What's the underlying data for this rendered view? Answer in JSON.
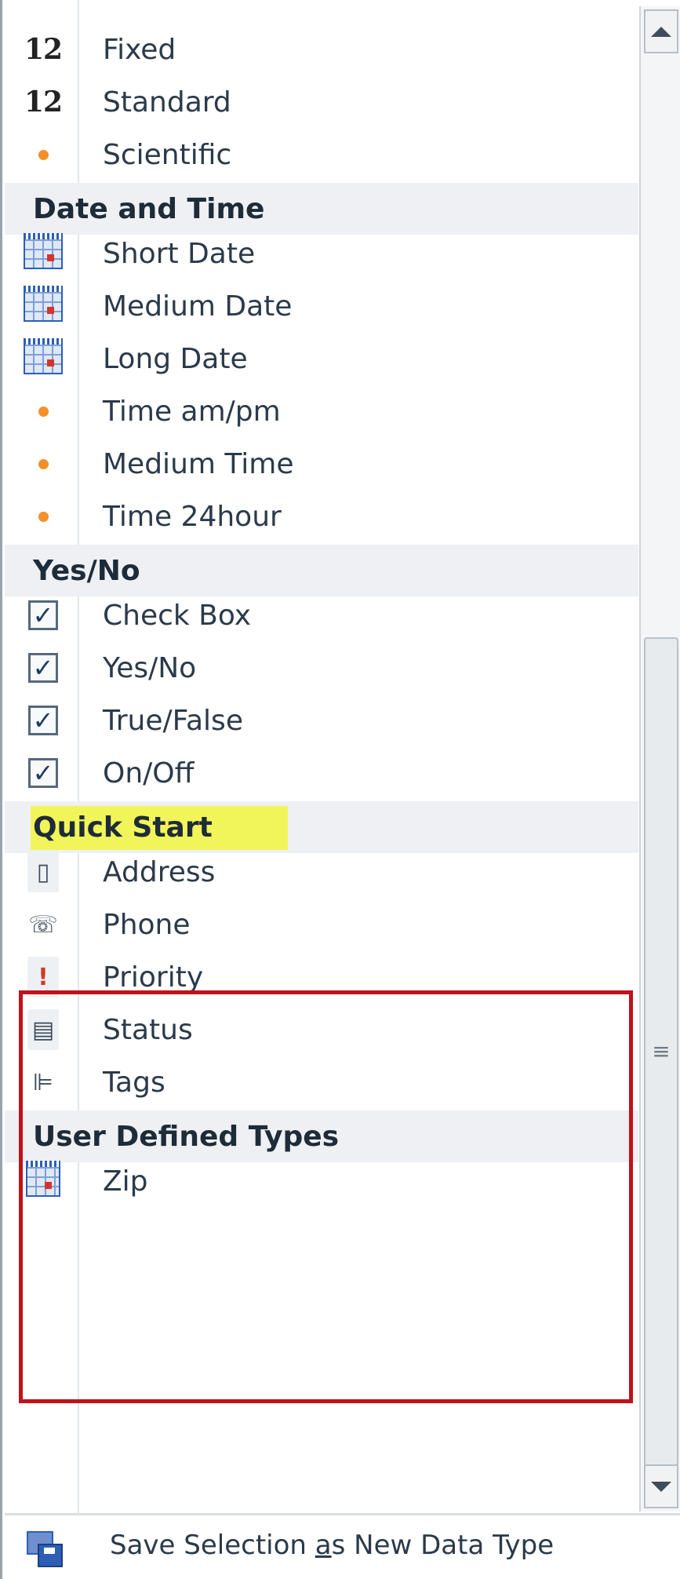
{
  "groups": [
    {
      "title": "",
      "items": [
        {
          "label": "Fixed",
          "icon": "number-12-icon"
        },
        {
          "label": "Standard",
          "icon": "number-12-icon"
        },
        {
          "label": "Scientific",
          "icon": "orange-dot-icon"
        }
      ]
    },
    {
      "title": "Date and Time",
      "items": [
        {
          "label": "Short Date",
          "icon": "calendar-icon"
        },
        {
          "label": "Medium Date",
          "icon": "calendar-icon"
        },
        {
          "label": "Long Date",
          "icon": "calendar-icon"
        },
        {
          "label": "Time am/pm",
          "icon": "orange-dot-icon"
        },
        {
          "label": "Medium Time",
          "icon": "orange-dot-icon"
        },
        {
          "label": "Time 24hour",
          "icon": "orange-dot-icon"
        }
      ]
    },
    {
      "title": "Yes/No",
      "items": [
        {
          "label": "Check Box",
          "icon": "checkbox-icon"
        },
        {
          "label": "Yes/No",
          "icon": "checkbox-icon"
        },
        {
          "label": "True/False",
          "icon": "checkbox-icon"
        },
        {
          "label": "On/Off",
          "icon": "checkbox-icon"
        }
      ]
    },
    {
      "title": "Quick Start",
      "items": [
        {
          "label": "Address",
          "icon": "address-icon"
        },
        {
          "label": "Phone",
          "icon": "phone-icon"
        },
        {
          "label": "Priority",
          "icon": "priority-icon"
        },
        {
          "label": "Status",
          "icon": "status-icon"
        },
        {
          "label": "Tags",
          "icon": "tags-icon"
        }
      ]
    },
    {
      "title": "User Defined Types",
      "items": [
        {
          "label": "Zip",
          "icon": "custom-type-icon"
        }
      ]
    }
  ],
  "numIconText": "12",
  "checkGlyph": "✓",
  "footer": {
    "label_pre": "Save Selection ",
    "label_access": "a",
    "label_post": "s New Data Type",
    "icon": "save-data-type-icon"
  },
  "highlight": {
    "group": "Quick Start",
    "frame_color": "#c2111a",
    "marker_color": "#f2f55a"
  },
  "colors": {
    "accent_orange": "#f3902a",
    "header_bg": "#eef0f3"
  }
}
